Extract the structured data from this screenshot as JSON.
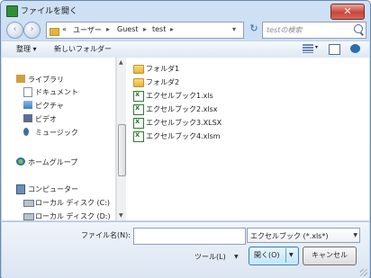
{
  "window": {
    "title": "ファイルを開く",
    "close_glyph": "✕"
  },
  "address": {
    "back_glyph": "‹",
    "forward_glyph": "›",
    "overflow": "«",
    "segments": [
      "ユーザー",
      "Guest",
      "test"
    ],
    "separator": "▸",
    "dropdown_glyph": "▾",
    "refresh_glyph": "↻"
  },
  "search": {
    "placeholder": "testの検索"
  },
  "toolbar": {
    "organize_label": "整理 ▾",
    "new_folder_label": "新しいフォルダー",
    "view_glyph": "▾"
  },
  "nav": [
    {
      "label": "ライブラリ",
      "icon": "library-icon"
    },
    {
      "label": "ドキュメント",
      "icon": "documents-icon"
    },
    {
      "label": "ピクチャ",
      "icon": "pictures-icon"
    },
    {
      "label": "ビデオ",
      "icon": "videos-icon"
    },
    {
      "label": "ミュージック",
      "icon": "music-icon"
    },
    {
      "label": "ホームグループ",
      "icon": "homegroup-icon"
    },
    {
      "label": "コンピューター",
      "icon": "computer-icon"
    },
    {
      "label": "ローカル ディスク (C:)",
      "icon": "drive-icon"
    },
    {
      "label": "ローカル ディスク (D:)",
      "icon": "drive-icon"
    }
  ],
  "files": [
    {
      "name": "フォルダ1",
      "type": "folder"
    },
    {
      "name": "フォルダ2",
      "type": "folder"
    },
    {
      "name": "エクセルブック1.xls",
      "type": "excel"
    },
    {
      "name": "エクセルブック2.xlsx",
      "type": "excel"
    },
    {
      "name": "エクセルブック3.XLSX",
      "type": "excel"
    },
    {
      "name": "エクセルブック4.xlsm",
      "type": "excel"
    }
  ],
  "bottom": {
    "filename_label": "ファイル名(N):",
    "filename_value": "",
    "filetype_selected": "エクセルブック (*.xls*)",
    "tools_label": "ツール(L)",
    "open_label": "開く(O)",
    "cancel_label": "キャンセル"
  },
  "colors": {
    "frame": "#b9d1ec",
    "accent": "#3c7fb1",
    "excel": "#2e7d32",
    "folder": "#e5b23e"
  }
}
